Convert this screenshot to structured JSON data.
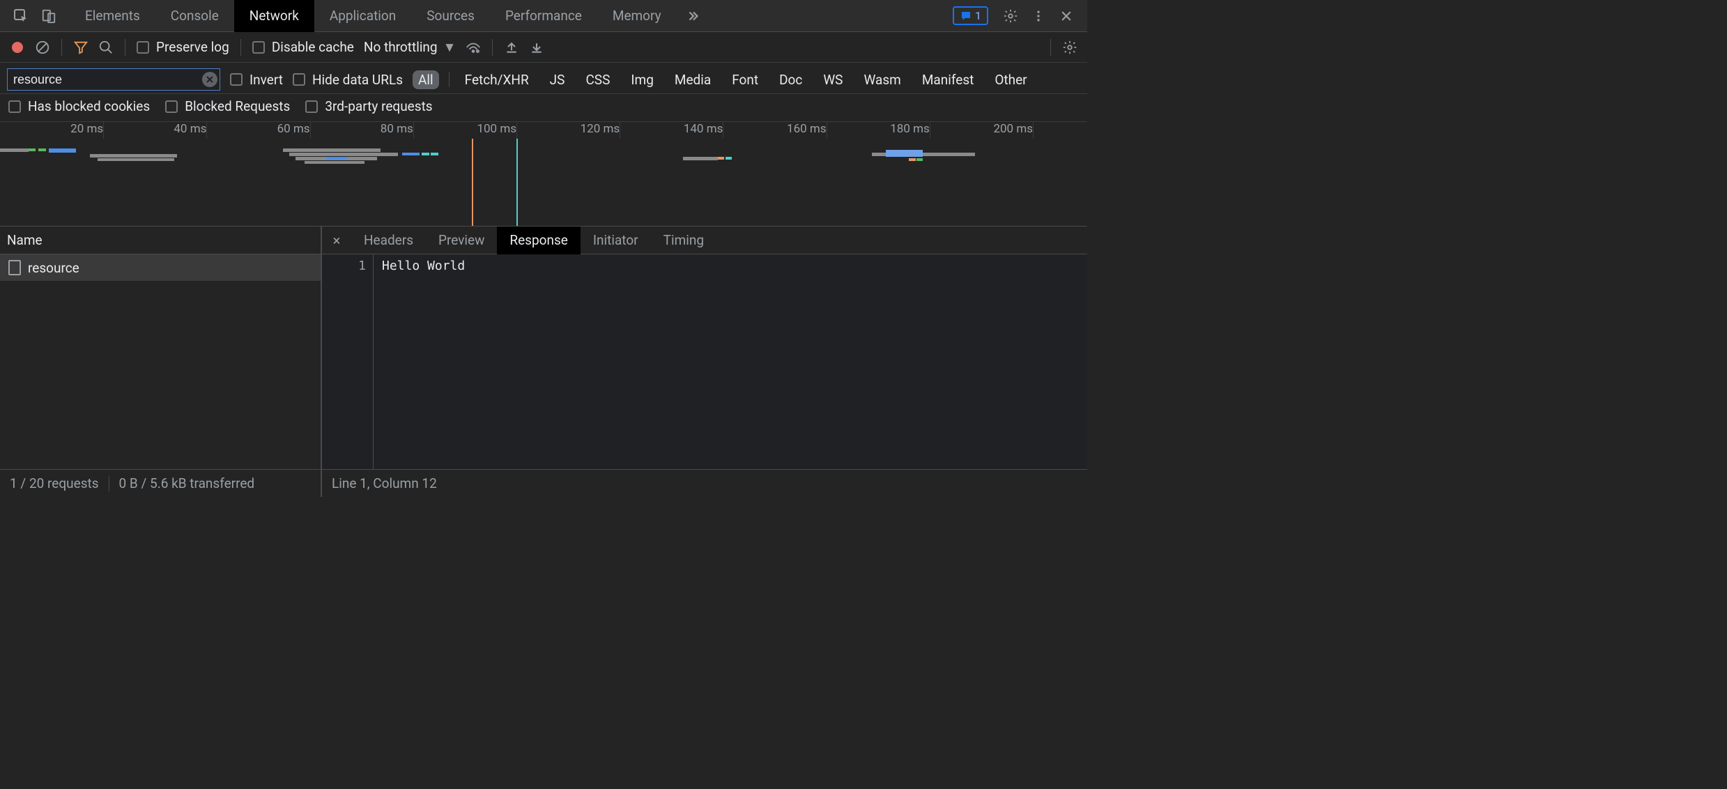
{
  "tabstrip": {
    "tabs": [
      {
        "label": "Elements",
        "active": false
      },
      {
        "label": "Console",
        "active": false
      },
      {
        "label": "Network",
        "active": true
      },
      {
        "label": "Application",
        "active": false
      },
      {
        "label": "Sources",
        "active": false
      },
      {
        "label": "Performance",
        "active": false
      },
      {
        "label": "Memory",
        "active": false
      }
    ],
    "badge_count": "1"
  },
  "toolbar": {
    "preserve_log": "Preserve log",
    "disable_cache": "Disable cache",
    "throttling": "No throttling"
  },
  "filter": {
    "value": "resource",
    "invert": "Invert",
    "hide_data_urls": "Hide data URLs",
    "types": [
      "All",
      "Fetch/XHR",
      "JS",
      "CSS",
      "Img",
      "Media",
      "Font",
      "Doc",
      "WS",
      "Wasm",
      "Manifest",
      "Other"
    ],
    "active_type": "All",
    "has_blocked_cookies": "Has blocked cookies",
    "blocked_requests": "Blocked Requests",
    "third_party": "3rd-party requests"
  },
  "overview": {
    "ticks": [
      "20 ms",
      "40 ms",
      "60 ms",
      "80 ms",
      "100 ms",
      "120 ms",
      "140 ms",
      "160 ms",
      "180 ms",
      "200 ms"
    ]
  },
  "requests": {
    "header": "Name",
    "items": [
      {
        "name": "resource"
      }
    ]
  },
  "detail": {
    "tabs": [
      "Headers",
      "Preview",
      "Response",
      "Initiator",
      "Timing"
    ],
    "active": "Response",
    "response_line_no": "1",
    "response_body": "Hello World"
  },
  "status": {
    "requests": "1 / 20 requests",
    "transferred": "0 B / 5.6 kB transferred",
    "cursor": "Line 1, Column 12"
  }
}
